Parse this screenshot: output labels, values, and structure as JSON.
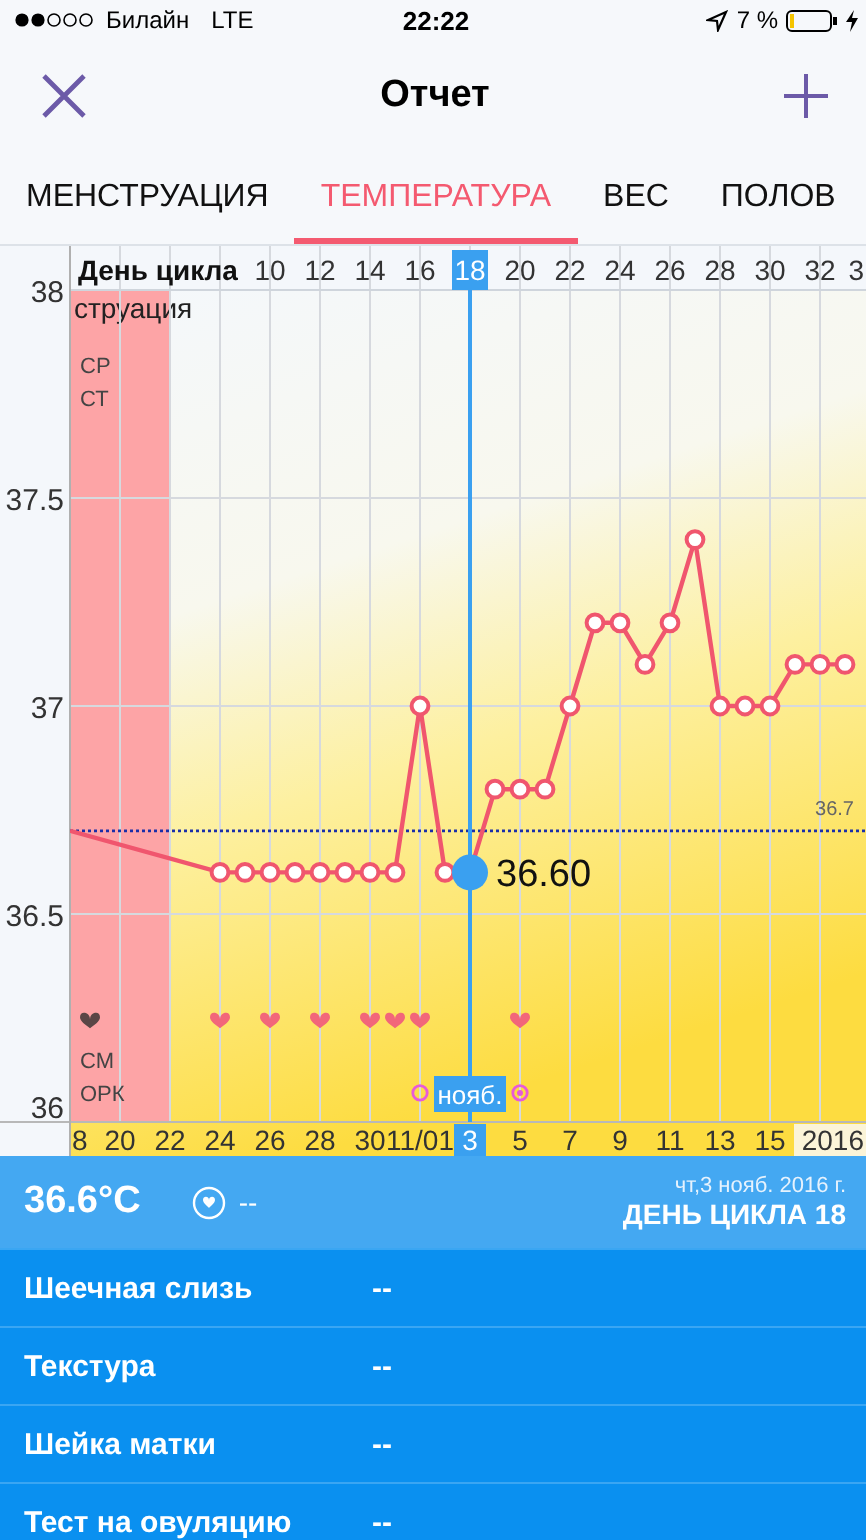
{
  "status_bar": {
    "carrier": "Билайн",
    "network": "LTE",
    "time": "22:22",
    "battery": "7 %"
  },
  "nav_bar": {
    "title": "Отчет"
  },
  "tabs": [
    {
      "label": "МЕНСТРУАЦИЯ",
      "selected": false
    },
    {
      "label": "ТЕМПЕРАТУРА",
      "selected": true
    },
    {
      "label": "ВЕС",
      "selected": false
    },
    {
      "label": "ПОЛОВ",
      "selected": false
    }
  ],
  "chart": {
    "cycle_day_label": "День цикла",
    "cycle_days": [
      {
        "label": "10",
        "selected": false
      },
      {
        "label": "12",
        "selected": false
      },
      {
        "label": "14",
        "selected": false
      },
      {
        "label": "16",
        "selected": false
      },
      {
        "label": "18",
        "selected": true
      },
      {
        "label": "20",
        "selected": false
      },
      {
        "label": "22",
        "selected": false
      },
      {
        "label": "24",
        "selected": false
      },
      {
        "label": "26",
        "selected": false
      },
      {
        "label": "28",
        "selected": false
      },
      {
        "label": "30",
        "selected": false
      },
      {
        "label": "32",
        "selected": false
      },
      {
        "label": "3",
        "selected": false
      }
    ],
    "legend_labels": [
      "СР",
      "СТ",
      "СМ",
      "ОРК"
    ],
    "menstruation_label": "струация",
    "days": [
      {
        "kind": "menstruation"
      },
      {
        "kind": "menstruation"
      },
      {
        "kind": "menstruation"
      },
      {
        "kind": "menstruation"
      },
      {
        "kind": "plain"
      },
      {
        "kind": "plain"
      },
      {
        "kind": "heart"
      },
      {
        "kind": "plain"
      },
      {
        "kind": "heart"
      },
      {
        "kind": "plain"
      },
      {
        "kind": "heart"
      },
      {
        "kind": "plain"
      },
      {
        "kind": "heart"
      },
      {
        "kind": "heart"
      },
      {
        "kind": "heart_test"
      },
      {
        "kind": "plain"
      },
      {
        "kind": "plain"
      },
      {
        "kind": "plain"
      },
      {
        "kind": "heart_test_positive"
      },
      {
        "kind": "plain"
      },
      {
        "kind": "plain"
      },
      {
        "kind": "plain"
      },
      {
        "kind": "plain"
      },
      {
        "kind": "plain"
      },
      {
        "kind": "plain"
      },
      {
        "kind": "plain"
      },
      {
        "kind": "plain"
      },
      {
        "kind": "plain"
      },
      {
        "kind": "plain"
      },
      {
        "kind": "plain"
      },
      {
        "kind": "plain"
      },
      {
        "kind": "plain"
      }
    ],
    "selected_value": "36.60",
    "month_tag": "нояб.",
    "chart_data": {
      "type": "line",
      "grid": true,
      "categories": [
        "8",
        null,
        "20",
        null,
        "22",
        null,
        "24",
        null,
        "26",
        null,
        "28",
        null,
        "30",
        null,
        "11/01",
        null,
        "3",
        null,
        "5",
        null,
        "7",
        null,
        "9",
        null,
        "11",
        null,
        "13",
        null,
        "15",
        null,
        null,
        "2016"
      ],
      "series": [
        {
          "color": "#f0566e",
          "marker": "o",
          "values": [
            36.7,
            null,
            null,
            null,
            null,
            null,
            36.6,
            36.6,
            36.6,
            36.6,
            36.6,
            36.6,
            36.6,
            36.6,
            37.0,
            36.6,
            36.6,
            36.8,
            36.8,
            36.8,
            37.0,
            37.2,
            37.2,
            37.1,
            37.2,
            37.4,
            37.0,
            37.0,
            37.0,
            37.1,
            37.1,
            37.1
          ]
        }
      ],
      "ylim": [
        36,
        38
      ],
      "yticks": [
        36,
        36.5,
        37,
        37.5,
        38
      ],
      "ref_lines": [
        {
          "axis": "y",
          "value": 36.7,
          "label": "36.7",
          "color": "#1a2ea8"
        }
      ]
    }
  },
  "day_info": {
    "temperature": "36.6°C",
    "intercourse": "--",
    "date": "чт,3 нояб. 2016 г.",
    "cycle_day": "ДЕНЬ ЦИКЛА 18",
    "rows": [
      {
        "label": "Шеечная слизь",
        "value": "--"
      },
      {
        "label": "Текстура",
        "value": "--"
      },
      {
        "label": "Шейка матки",
        "value": "--"
      },
      {
        "label": "Тест на овуляцию",
        "value": "--"
      }
    ]
  }
}
